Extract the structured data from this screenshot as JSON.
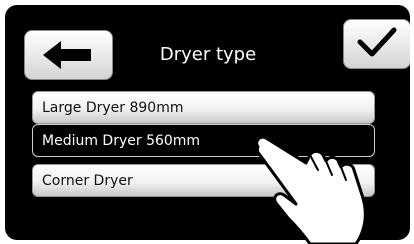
{
  "header": {
    "title": "Dryer type",
    "back_icon": "arrow-left-icon",
    "confirm_icon": "checkmark-icon"
  },
  "options": [
    {
      "label": "Large Dryer 890mm",
      "selected": false
    },
    {
      "label": "Medium Dryer 560mm",
      "selected": true
    },
    {
      "label": "Corner Dryer",
      "selected": false
    }
  ],
  "overlay": {
    "icon": "pointing-hand-icon"
  },
  "colors": {
    "screen_bg": "#000000",
    "button_light": "#ffffff",
    "button_dark": "#d4d4d4",
    "selected_border": "#cfcfcf"
  }
}
